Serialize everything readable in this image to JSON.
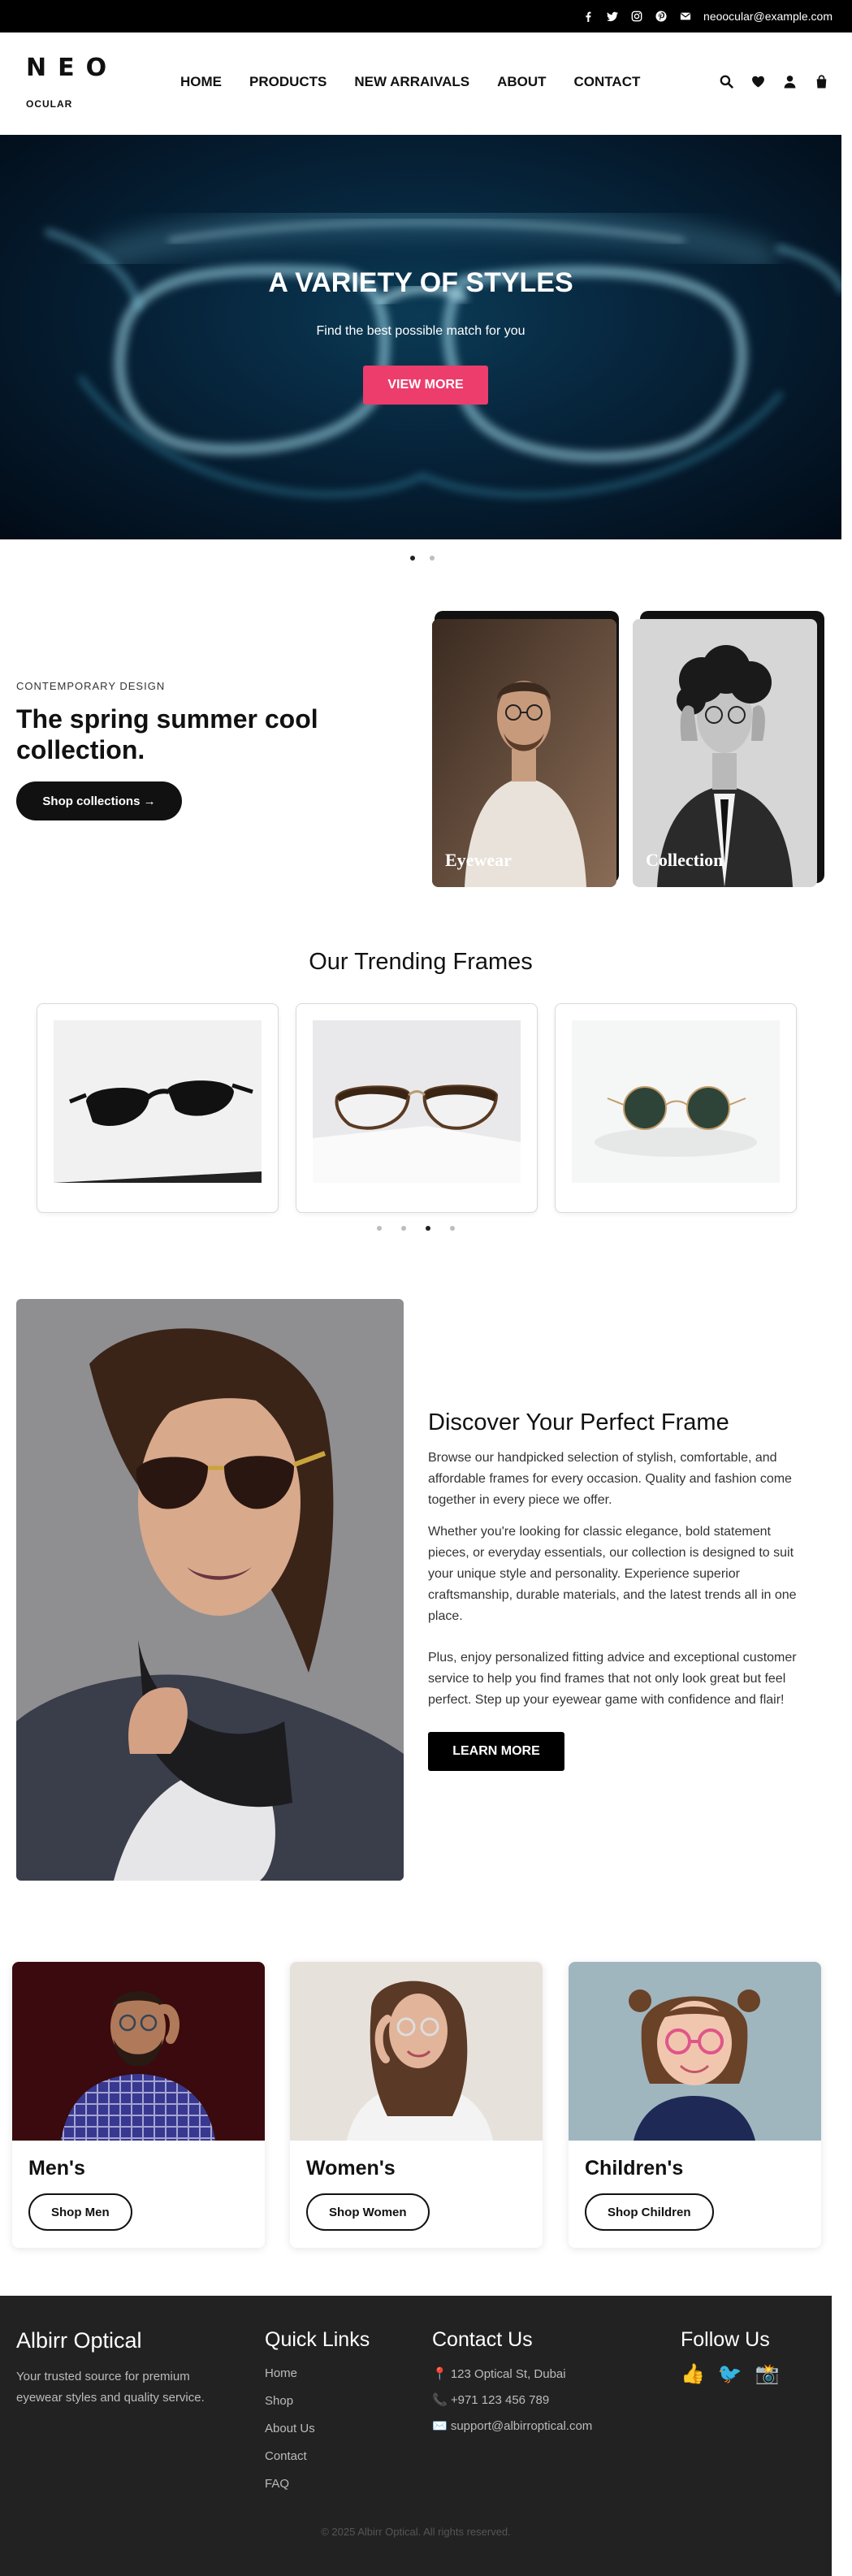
{
  "topbar": {
    "icons": [
      "facebook-icon",
      "twitter-icon",
      "instagram-icon",
      "pinterest-icon",
      "envelope-icon"
    ],
    "email": "neoocular@example.com"
  },
  "brand": {
    "logo": "NEO",
    "sub": "OCULAR"
  },
  "nav": {
    "items": [
      "HOME",
      "PRODUCTS",
      "NEW ARRAIVALS",
      "ABOUT",
      "CONTACT"
    ]
  },
  "header_icons": [
    "search-icon",
    "heart-icon",
    "user-icon",
    "bag-icon"
  ],
  "hero": {
    "title": "A VARIETY OF STYLES",
    "subtitle": "Find the best possible match for you",
    "button": "VIEW MORE",
    "accent": "#ec3d6c"
  },
  "spring": {
    "eyebrow": "CONTEMPORARY DESIGN",
    "title": "The spring summer cool collection.",
    "button": "Shop collections →",
    "cards": [
      {
        "label": "Eyewear"
      },
      {
        "label": "Collection"
      }
    ]
  },
  "trending": {
    "title": "Our Trending Frames"
  },
  "discover": {
    "title": "Discover Your Perfect Frame",
    "p1": "Browse our handpicked selection of stylish, comfortable, and affordable frames for every occasion. Quality and fashion come together in every piece we offer.",
    "p2": "Whether you're looking for classic elegance, bold statement pieces, or everyday essentials, our collection is designed to suit your unique style and personality. Experience superior craftsmanship, durable materials, and the latest trends all in one place.",
    "p3": "Plus, enjoy personalized fitting advice and exceptional customer service to help you find frames that not only look great but feel perfect. Step up your eyewear game with confidence and flair!",
    "button": "LEARN MORE"
  },
  "categories": [
    {
      "title": "Men's",
      "button": "Shop Men"
    },
    {
      "title": "Women's",
      "button": "Shop Women"
    },
    {
      "title": "Children's",
      "button": "Shop Children"
    }
  ],
  "footer": {
    "brand": "Albirr Optical",
    "tagline": "Your trusted source for premium eyewear styles and quality service.",
    "quick_links_title": "Quick Links",
    "quick_links": [
      "Home",
      "Shop",
      "About Us",
      "Contact",
      "FAQ"
    ],
    "contact_title": "Contact Us",
    "address": "📍 123 Optical St, Dubai",
    "phone": "📞 +971 123 456 789",
    "email": "✉️ support@albirroptical.com",
    "follow_title": "Follow Us",
    "social": [
      "👍",
      "🐦",
      "📸"
    ],
    "copyright": "© 2025 Albirr Optical. All rights reserved."
  }
}
